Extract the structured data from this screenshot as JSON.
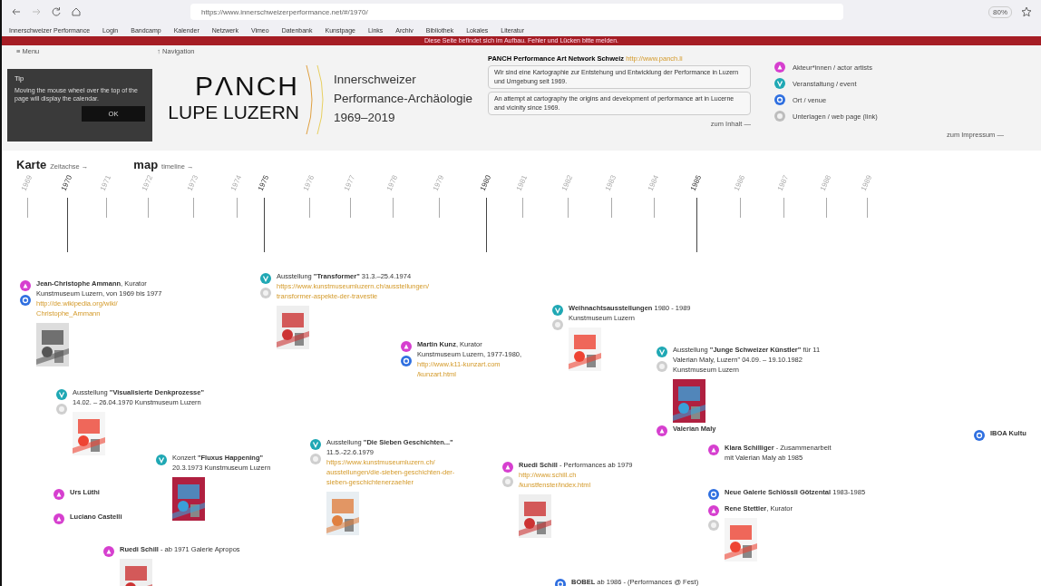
{
  "browser": {
    "url": "https://www.innerschweizerperformance.net/#/1970/",
    "zoom": "80%",
    "bookmarks": [
      "Innerschweizer Performance",
      "Login",
      "Bandcamp",
      "Kalender",
      "Netzwerk",
      "Vimeo",
      "Datenbank",
      "Kunstpage",
      "Links",
      "Archiv",
      "Bibliothek",
      "Lokales",
      "Literatur"
    ],
    "banner": "Diese Seite befindet sich im Aufbau. Fehler und Lücken bitte melden."
  },
  "header": {
    "menu": "≡ Menu",
    "navigation": "↑ Navigation",
    "logo_top": "PΛNCH",
    "logo_bottom": "LUPE LUZERN",
    "title_lines": [
      "Innerschweizer",
      "Performance-Archäologie",
      "1969–2019"
    ],
    "network_title": "PANCH Performance Art Network Schweiz",
    "network_link": "http://www.panch.li",
    "descriptions": [
      "Wir sind eine Kartographie zur Entstehung und Entwicklung der Performance in Luzern und Umgebung seit 1969.",
      "An attempt at cartography the origins and development of performance art in Lucerne and vicinity since 1969."
    ],
    "legend": [
      {
        "kind": "actor",
        "label": "Akteur*innen / actor artists",
        "color": "#d63fcf"
      },
      {
        "kind": "event",
        "label": "Veranstaltung / event",
        "color": "#1fa8b4"
      },
      {
        "kind": "venue",
        "label": "Ort / venue",
        "color": "#2f6fe0"
      },
      {
        "kind": "document",
        "label": "Unterlagen / web page (link)",
        "color": "#bdbdbd"
      }
    ],
    "left_more": "zum Inhalt —",
    "right_more": "zum Impressum —"
  },
  "tooltip": {
    "title": "Tip",
    "text": "Moving the mouse wheel over the top of the page will display the calendar.",
    "button": "OK"
  },
  "views": [
    {
      "label": "Karte",
      "hint": "Zeitachse →"
    },
    {
      "label": "map",
      "hint": "timeline →"
    }
  ],
  "timeline": {
    "years": [
      {
        "label": "1969",
        "major": false
      },
      {
        "label": "1970",
        "major": true
      },
      {
        "label": "1971",
        "major": false
      },
      {
        "label": "1972",
        "major": false
      },
      {
        "label": "1973",
        "major": false
      },
      {
        "label": "1974",
        "major": false
      },
      {
        "label": "1975",
        "major": true
      },
      {
        "label": "1976",
        "major": false
      },
      {
        "label": "1977",
        "major": false
      },
      {
        "label": "1978",
        "major": false
      },
      {
        "label": "1979",
        "major": false
      },
      {
        "label": "1980",
        "major": true
      },
      {
        "label": "1981",
        "major": false
      },
      {
        "label": "1982",
        "major": false
      },
      {
        "label": "1983",
        "major": false
      },
      {
        "label": "1984",
        "major": false
      },
      {
        "label": "1985",
        "major": true
      },
      {
        "label": "1986",
        "major": false
      },
      {
        "label": "1987",
        "major": false
      },
      {
        "label": "1988",
        "major": false
      },
      {
        "label": "1989",
        "major": false
      }
    ]
  },
  "entries": [
    {
      "markers": [
        {
          "kind": "actor"
        },
        {
          "kind": "venue"
        }
      ],
      "lines": [
        "**Jean-Christophe Ammann**, Kurator",
        "Kunstmuseum Luzern, von 1969 bis 1977"
      ],
      "links": [
        "http://de.wikipedia.org/wiki/",
        "Christophe_Ammann"
      ],
      "picture": true
    },
    {
      "markers": [
        {
          "kind": "event"
        },
        {
          "kind": "document"
        }
      ],
      "lines": [
        "Ausstellung **\"Transformer\"** 31.3.–25.4.1974"
      ],
      "links": [
        "https://www.kunstmuseumluzern.ch/ausstellungen/",
        "transformer-aspekte-der-travestie"
      ],
      "picture": true
    },
    {
      "markers": [
        {
          "kind": "actor"
        },
        {
          "kind": "venue"
        }
      ],
      "lines": [
        "**Martin Kunz**, Kurator",
        "Kunstmuseum Luzern, 1977-1980,"
      ],
      "links": [
        "http://www.k11-kunzart.com",
        "/kunzart.html"
      ],
      "picture": false
    },
    {
      "markers": [
        {
          "kind": "event"
        },
        {
          "kind": "document"
        }
      ],
      "lines": [
        "Ausstellung **\"Visualisierte Denkprozesse\"**",
        "14.02. – 26.04.1970 Kunstmuseum Luzern"
      ],
      "picture": true
    },
    {
      "markers": [
        {
          "kind": "event"
        }
      ],
      "lines": [
        "Konzert **\"Fluxus Happening\"**",
        "20.3.1973 Kunstmuseum Luzern"
      ],
      "picture": true
    },
    {
      "markers": [
        {
          "kind": "actor"
        }
      ],
      "lines": [
        "**Urs Lüthi**"
      ],
      "picture": false
    },
    {
      "markers": [
        {
          "kind": "actor"
        }
      ],
      "lines": [
        "**Luciano Castelli**"
      ],
      "picture": false
    },
    {
      "markers": [
        {
          "kind": "actor"
        }
      ],
      "lines": [
        "**Ruedi Schill** - ab 1971 Galerie Apropos"
      ],
      "picture": true
    },
    {
      "markers": [
        {
          "kind": "event"
        },
        {
          "kind": "document"
        }
      ],
      "lines": [
        "Ausstellung **\"Die Sieben Geschichten...\"**",
        "11.5.-22.6.1979"
      ],
      "links": [
        "https://www.kunstmuseumluzern.ch/",
        "ausstellungen/die-sieben-geschichten-der-",
        "sieben-geschichtenerzaehler"
      ],
      "picture": true
    },
    {
      "markers": [
        {
          "kind": "event"
        },
        {
          "kind": "document"
        }
      ],
      "lines": [
        "**Weihnachtsausstellungen** 1980 - 1989",
        "Kunstmuseum Luzern"
      ],
      "picture": true
    },
    {
      "markers": [
        {
          "kind": "event"
        },
        {
          "kind": "document"
        }
      ],
      "lines": [
        "Ausstellung **\"Junge Schweizer Künstler\"** für 11",
        "Valerian Maly, Luzern\" 04.09. – 19.10.1982",
        "Kunstmuseum Luzern"
      ],
      "picture": true
    },
    {
      "markers": [
        {
          "kind": "actor"
        }
      ],
      "lines": [
        "**Valerian Maly**"
      ],
      "picture": false
    },
    {
      "markers": [
        {
          "kind": "actor"
        }
      ],
      "lines": [
        "**Klara Schilliger** - Zusammenarbeit",
        "mit Valerian Maly ab 1985"
      ],
      "picture": false
    },
    {
      "markers": [
        {
          "kind": "actor"
        },
        {
          "kind": "document"
        }
      ],
      "lines": [
        "**Ruedi Schill** - Performances ab 1979"
      ],
      "links": [
        "http://www.schill.ch",
        "/kunstfenster/index.html"
      ],
      "picture": true
    },
    {
      "markers": [
        {
          "kind": "venue"
        }
      ],
      "lines": [
        "**Neue Galerie Schlössli Götzental** 1983-1985"
      ],
      "picture": false
    },
    {
      "markers": [
        {
          "kind": "actor"
        },
        {
          "kind": "document"
        }
      ],
      "lines": [
        "**Rene Stettler**, Kurator"
      ],
      "picture": true
    },
    {
      "markers": [
        {
          "kind": "venue"
        }
      ],
      "lines": [
        "**BOBEL** ab 1986 - (Performances @ Fest)"
      ],
      "picture": false
    },
    {
      "markers": [
        {
          "kind": "venue"
        }
      ],
      "lines": [
        "**IBOA Kultu**"
      ],
      "picture": false
    }
  ]
}
